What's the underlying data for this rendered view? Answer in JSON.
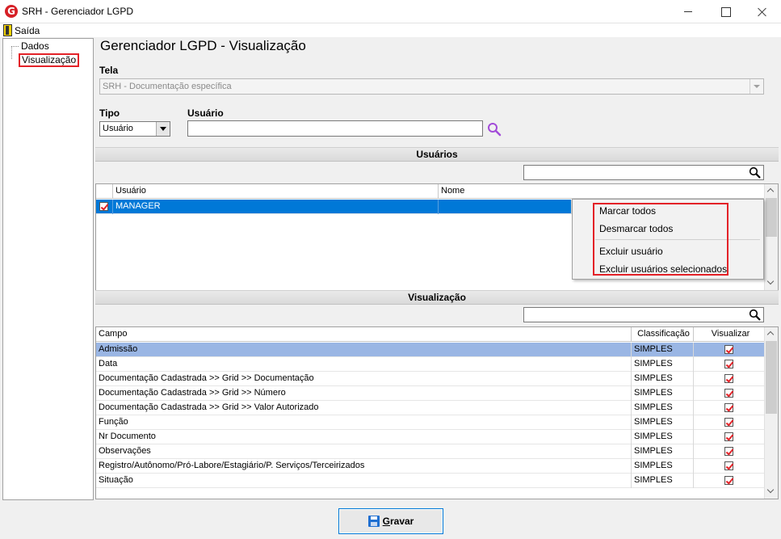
{
  "window": {
    "title": "SRH - Gerenciador LGPD"
  },
  "menu": {
    "exit_label": "Saída"
  },
  "tree": {
    "items": [
      {
        "label": "Dados"
      },
      {
        "label": "Visualização"
      }
    ]
  },
  "page": {
    "title": "Gerenciador LGPD - Visualização"
  },
  "tela": {
    "label": "Tela",
    "value": "SRH - Documentação específica"
  },
  "tipo": {
    "label": "Tipo",
    "value": "Usuário"
  },
  "usuario": {
    "label": "Usuário",
    "value": ""
  },
  "usuarios_section": {
    "header": "Usuários",
    "search_value": "",
    "columns": [
      "Usuário",
      "Nome"
    ],
    "rows": [
      {
        "checked": true,
        "usuario": "MANAGER",
        "nome": ""
      }
    ]
  },
  "context_menu": {
    "items": [
      "Marcar todos",
      "Desmarcar todos",
      "Excluir usuário",
      "Excluir usuários selecionados"
    ]
  },
  "visualizacao_section": {
    "header": "Visualização",
    "search_value": "",
    "columns": [
      "Campo",
      "Classificação",
      "Visualizar"
    ],
    "rows": [
      {
        "campo": "Admissão",
        "classificacao": "SIMPLES",
        "visualizar": true
      },
      {
        "campo": "Data",
        "classificacao": "SIMPLES",
        "visualizar": true
      },
      {
        "campo": "Documentação Cadastrada >> Grid >> Documentação",
        "classificacao": "SIMPLES",
        "visualizar": true
      },
      {
        "campo": "Documentação Cadastrada >> Grid >> Número",
        "classificacao": "SIMPLES",
        "visualizar": true
      },
      {
        "campo": "Documentação Cadastrada >> Grid >> Valor Autorizado",
        "classificacao": "SIMPLES",
        "visualizar": true
      },
      {
        "campo": "Função",
        "classificacao": "SIMPLES",
        "visualizar": true
      },
      {
        "campo": "Nr Documento",
        "classificacao": "SIMPLES",
        "visualizar": true
      },
      {
        "campo": "Observações",
        "classificacao": "SIMPLES",
        "visualizar": true
      },
      {
        "campo": "Registro/Autônomo/Pró-Labore/Estagiário/P. Serviços/Terceirizados",
        "classificacao": "SIMPLES",
        "visualizar": true
      },
      {
        "campo": "Situação",
        "classificacao": "SIMPLES",
        "visualizar": true
      }
    ]
  },
  "save_button": {
    "mnemonic": "G",
    "label_rest": "ravar"
  },
  "colors": {
    "selection_blue": "#0078d7",
    "highlight_row": "#9ab6e4",
    "annotation_red": "#e32228",
    "check_red": "#e32228",
    "lookup_purple": "#a24bd8"
  }
}
